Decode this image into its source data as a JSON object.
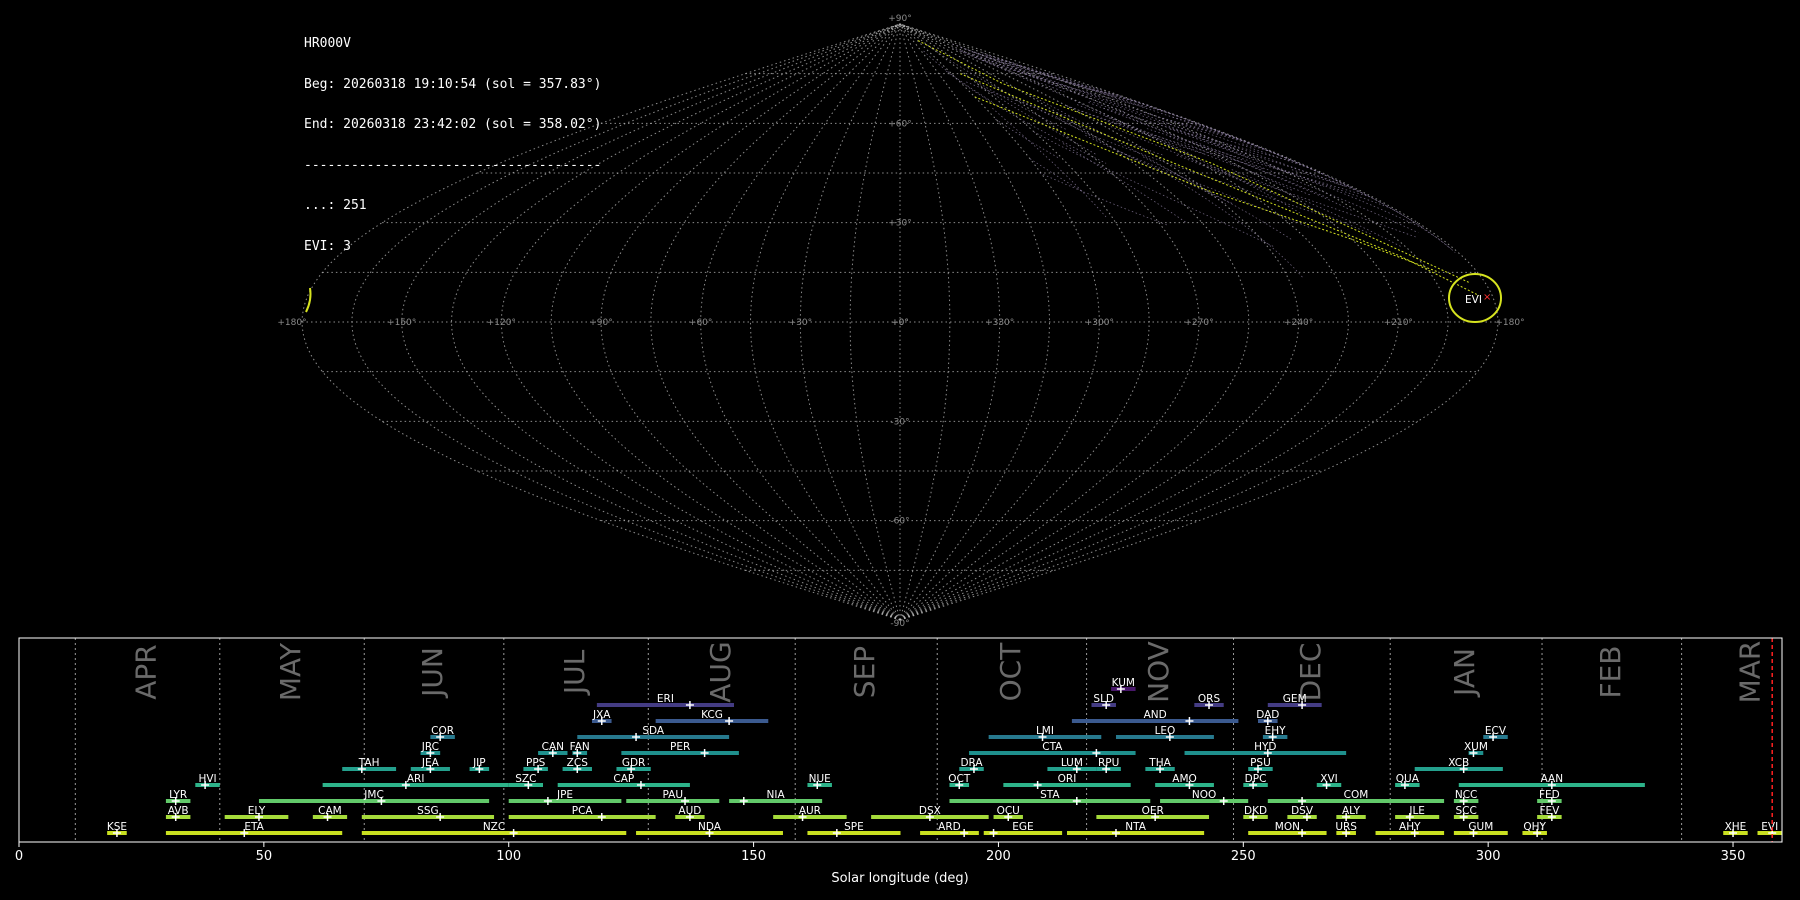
{
  "header": {
    "station": "HR000V",
    "beg": "Beg: 20260318 19:10:54 (sol = 357.83°)",
    "end": "End: 20260318 23:42:02 (sol = 358.02°)",
    "separator": "--------------------------------------",
    "sporadic_line": "...: 251",
    "evi_line": "EVI: 3"
  },
  "sky_map": {
    "projection": "sinusoidal",
    "ra_labels": [
      "+180°",
      "+150°",
      "+120°",
      "+90°",
      "+60°",
      "+30°",
      "+0°",
      "+330°",
      "+300°",
      "+270°",
      "+240°",
      "+210°",
      "+180°"
    ],
    "dec_labels": [
      "+90°",
      "+60°",
      "+30°",
      "+0°",
      "-30°",
      "-60°",
      "-90°"
    ],
    "radiant_label": "EVI",
    "colors": {
      "background": "#000000",
      "grid": "#bbbbbb",
      "sporadic": "#8c7ea0",
      "shower": "#d6e31f",
      "radiant": "#ff3030"
    }
  },
  "chart_data": {
    "type": "range_bars",
    "xlabel": "Solar longitude (deg)",
    "xlim": [
      0,
      360
    ],
    "xticks": [
      0,
      50,
      100,
      150,
      200,
      250,
      300,
      350
    ],
    "current_sol": 358.0,
    "months": [
      {
        "name": "APR",
        "start": 11.5
      },
      {
        "name": "MAY",
        "start": 41
      },
      {
        "name": "JUN",
        "start": 70.5
      },
      {
        "name": "JUL",
        "start": 99
      },
      {
        "name": "AUG",
        "start": 128.5
      },
      {
        "name": "SEP",
        "start": 158.5
      },
      {
        "name": "OCT",
        "start": 187.5
      },
      {
        "name": "NOV",
        "start": 218
      },
      {
        "name": "DEC",
        "start": 248
      },
      {
        "name": "JAN",
        "start": 280
      },
      {
        "name": "FEB",
        "start": 311
      },
      {
        "name": "MAR",
        "start": 339.5
      }
    ],
    "showers": [
      {
        "code": "KSE",
        "start": 18,
        "end": 22,
        "peak": 20,
        "row": 0
      },
      {
        "code": "ETA",
        "start": 30,
        "end": 66,
        "peak": 46,
        "row": 0
      },
      {
        "code": "NZC",
        "start": 70,
        "end": 124,
        "peak": 101,
        "row": 0
      },
      {
        "code": "NDA",
        "start": 126,
        "end": 156,
        "peak": 141,
        "row": 0
      },
      {
        "code": "SPE",
        "start": 161,
        "end": 180,
        "peak": 167,
        "row": 0
      },
      {
        "code": "ARD",
        "start": 184,
        "end": 196,
        "peak": 193,
        "row": 0
      },
      {
        "code": "EGE",
        "start": 197,
        "end": 213,
        "peak": 199,
        "row": 0
      },
      {
        "code": "NTA",
        "start": 214,
        "end": 242,
        "peak": 224,
        "row": 0
      },
      {
        "code": "MON",
        "start": 251,
        "end": 267,
        "peak": 262,
        "row": 0
      },
      {
        "code": "URS",
        "start": 269,
        "end": 273,
        "peak": 271,
        "row": 0
      },
      {
        "code": "AHY",
        "start": 277,
        "end": 291,
        "peak": 285,
        "row": 0
      },
      {
        "code": "GUM",
        "start": 293,
        "end": 304,
        "peak": 297,
        "row": 0
      },
      {
        "code": "QHY",
        "start": 307,
        "end": 312,
        "peak": 310,
        "row": 0
      },
      {
        "code": "XHE",
        "start": 348,
        "end": 353,
        "peak": 350,
        "row": 0
      },
      {
        "code": "EVI",
        "start": 355,
        "end": 360,
        "peak": 358,
        "row": 0
      },
      {
        "code": "AVB",
        "start": 30,
        "end": 35,
        "peak": 32,
        "row": 1
      },
      {
        "code": "ELY",
        "start": 42,
        "end": 55,
        "peak": 49,
        "row": 1
      },
      {
        "code": "CAM",
        "start": 60,
        "end": 67,
        "peak": 63,
        "row": 1
      },
      {
        "code": "SSG",
        "start": 70,
        "end": 97,
        "peak": 86,
        "row": 1
      },
      {
        "code": "PCA",
        "start": 100,
        "end": 130,
        "peak": 119,
        "row": 1
      },
      {
        "code": "AUD",
        "start": 134,
        "end": 140,
        "peak": 137,
        "row": 1
      },
      {
        "code": "AUR",
        "start": 154,
        "end": 169,
        "peak": 160,
        "row": 1
      },
      {
        "code": "DSX",
        "start": 174,
        "end": 198,
        "peak": 186,
        "row": 1
      },
      {
        "code": "OCU",
        "start": 199,
        "end": 205,
        "peak": 202,
        "row": 1
      },
      {
        "code": "OER",
        "start": 220,
        "end": 243,
        "peak": 232,
        "row": 1
      },
      {
        "code": "DKD",
        "start": 250,
        "end": 255,
        "peak": 252,
        "row": 1
      },
      {
        "code": "DSV",
        "start": 259,
        "end": 265,
        "peak": 263,
        "row": 1
      },
      {
        "code": "ALY",
        "start": 269,
        "end": 275,
        "peak": 271,
        "row": 1
      },
      {
        "code": "JLE",
        "start": 281,
        "end": 290,
        "peak": 284,
        "row": 1
      },
      {
        "code": "SCC",
        "start": 293,
        "end": 298,
        "peak": 295,
        "row": 1
      },
      {
        "code": "FEV",
        "start": 310,
        "end": 315,
        "peak": 313,
        "row": 1
      },
      {
        "code": "LYR",
        "start": 30,
        "end": 35,
        "peak": 32,
        "row": 2
      },
      {
        "code": "JMC",
        "start": 49,
        "end": 96,
        "peak": 74,
        "row": 2
      },
      {
        "code": "JPE",
        "start": 100,
        "end": 123,
        "peak": 108,
        "row": 2
      },
      {
        "code": "PAU",
        "start": 124,
        "end": 143,
        "peak": 136,
        "row": 2
      },
      {
        "code": "NIA",
        "start": 145,
        "end": 164,
        "peak": 148,
        "row": 2
      },
      {
        "code": "STA",
        "start": 190,
        "end": 231,
        "peak": 216,
        "row": 2
      },
      {
        "code": "NOO",
        "start": 233,
        "end": 251,
        "peak": 246,
        "row": 2
      },
      {
        "code": "COM",
        "start": 255,
        "end": 291,
        "peak": 262,
        "row": 2
      },
      {
        "code": "NCC",
        "start": 293,
        "end": 298,
        "peak": 295,
        "row": 2
      },
      {
        "code": "FED",
        "start": 310,
        "end": 315,
        "peak": 313,
        "row": 2
      },
      {
        "code": "HVI",
        "start": 36,
        "end": 41,
        "peak": 38,
        "row": 3
      },
      {
        "code": "ARI",
        "start": 62,
        "end": 100,
        "peak": 79,
        "row": 3
      },
      {
        "code": "SZC",
        "start": 100,
        "end": 107,
        "peak": 104,
        "row": 3
      },
      {
        "code": "CAP",
        "start": 110,
        "end": 137,
        "peak": 127,
        "row": 3
      },
      {
        "code": "NUE",
        "start": 161,
        "end": 166,
        "peak": 163,
        "row": 3
      },
      {
        "code": "OCT",
        "start": 190,
        "end": 194,
        "peak": 192,
        "row": 3
      },
      {
        "code": "ORI",
        "start": 201,
        "end": 227,
        "peak": 208,
        "row": 3
      },
      {
        "code": "AMO",
        "start": 232,
        "end": 244,
        "peak": 239,
        "row": 3
      },
      {
        "code": "DPC",
        "start": 250,
        "end": 255,
        "peak": 252,
        "row": 3
      },
      {
        "code": "XVI",
        "start": 265,
        "end": 270,
        "peak": 267,
        "row": 3
      },
      {
        "code": "QUA",
        "start": 281,
        "end": 286,
        "peak": 283,
        "row": 3
      },
      {
        "code": "AAN",
        "start": 294,
        "end": 332,
        "peak": 313,
        "row": 3
      },
      {
        "code": "TAH",
        "start": 66,
        "end": 77,
        "peak": 70,
        "row": 4
      },
      {
        "code": "JEA",
        "start": 80,
        "end": 88,
        "peak": 84,
        "row": 4
      },
      {
        "code": "JIP",
        "start": 92,
        "end": 96,
        "peak": 94,
        "row": 4
      },
      {
        "code": "PPS",
        "start": 103,
        "end": 108,
        "peak": 106,
        "row": 4
      },
      {
        "code": "ZCS",
        "start": 111,
        "end": 117,
        "peak": 114,
        "row": 4
      },
      {
        "code": "GDR",
        "start": 122,
        "end": 129,
        "peak": 125,
        "row": 4
      },
      {
        "code": "DRA",
        "start": 192,
        "end": 197,
        "peak": 195,
        "row": 4
      },
      {
        "code": "LUM",
        "start": 210,
        "end": 220,
        "peak": 216,
        "row": 4
      },
      {
        "code": "RPU",
        "start": 220,
        "end": 225,
        "peak": 222,
        "row": 4
      },
      {
        "code": "THA",
        "start": 230,
        "end": 236,
        "peak": 233,
        "row": 4
      },
      {
        "code": "PSU",
        "start": 251,
        "end": 256,
        "peak": 253,
        "row": 4
      },
      {
        "code": "XCB",
        "start": 285,
        "end": 303,
        "peak": 295,
        "row": 4
      },
      {
        "code": "JRC",
        "start": 82,
        "end": 86,
        "peak": 84,
        "row": 5
      },
      {
        "code": "CAN",
        "start": 106,
        "end": 112,
        "peak": 109,
        "row": 5
      },
      {
        "code": "FAN",
        "start": 113,
        "end": 116,
        "peak": 114,
        "row": 5
      },
      {
        "code": "PER",
        "start": 123,
        "end": 147,
        "peak": 140,
        "row": 5
      },
      {
        "code": "CTA",
        "start": 194,
        "end": 228,
        "peak": 220,
        "row": 5
      },
      {
        "code": "HYD",
        "start": 238,
        "end": 271,
        "peak": 255,
        "row": 5
      },
      {
        "code": "XUM",
        "start": 296,
        "end": 299,
        "peak": 297,
        "row": 5
      },
      {
        "code": "COR",
        "start": 84,
        "end": 89,
        "peak": 86,
        "row": 6
      },
      {
        "code": "SDA",
        "start": 114,
        "end": 145,
        "peak": 126,
        "row": 6
      },
      {
        "code": "LMI",
        "start": 198,
        "end": 221,
        "peak": 209,
        "row": 6
      },
      {
        "code": "LEO",
        "start": 224,
        "end": 244,
        "peak": 235,
        "row": 6
      },
      {
        "code": "EHY",
        "start": 254,
        "end": 259,
        "peak": 256,
        "row": 6
      },
      {
        "code": "ECV",
        "start": 299,
        "end": 304,
        "peak": 301,
        "row": 6
      },
      {
        "code": "JXA",
        "start": 117,
        "end": 121,
        "peak": 119,
        "row": 7
      },
      {
        "code": "KCG",
        "start": 130,
        "end": 153,
        "peak": 145,
        "row": 7
      },
      {
        "code": "AND",
        "start": 215,
        "end": 249,
        "peak": 239,
        "row": 7
      },
      {
        "code": "DAD",
        "start": 253,
        "end": 257,
        "peak": 255,
        "row": 7
      },
      {
        "code": "ERI",
        "start": 118,
        "end": 146,
        "peak": 137,
        "row": 8
      },
      {
        "code": "SLD",
        "start": 219,
        "end": 224,
        "peak": 222,
        "row": 8
      },
      {
        "code": "ORS",
        "start": 240,
        "end": 246,
        "peak": 243,
        "row": 8
      },
      {
        "code": "GEM",
        "start": 255,
        "end": 266,
        "peak": 262,
        "row": 8
      },
      {
        "code": "KUM",
        "start": 223,
        "end": 228,
        "peak": 225,
        "row": 9
      }
    ]
  }
}
